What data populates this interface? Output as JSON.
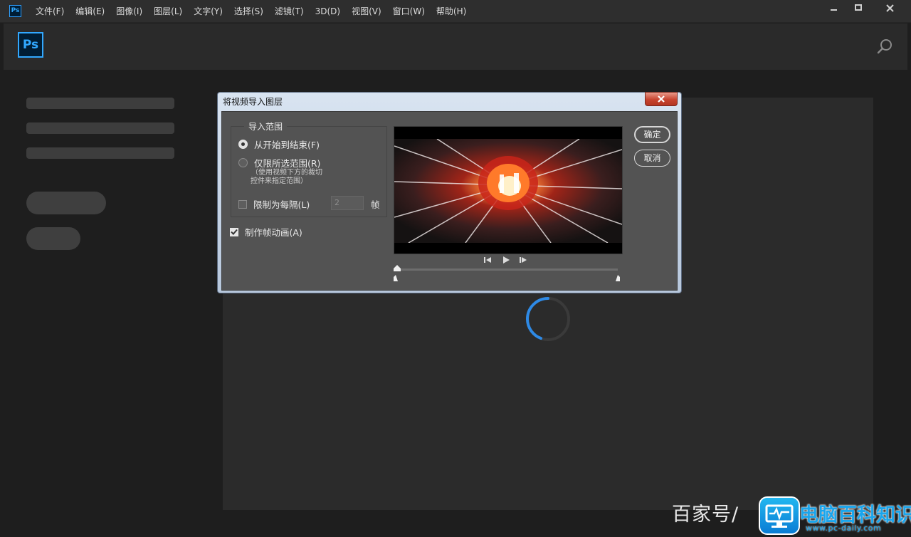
{
  "app": {
    "icon_label": "Ps",
    "logo_label": "Ps"
  },
  "menu": {
    "items": [
      "文件(F)",
      "编辑(E)",
      "图像(I)",
      "图层(L)",
      "文字(Y)",
      "选择(S)",
      "滤镜(T)",
      "3D(D)",
      "视图(V)",
      "窗口(W)",
      "帮助(H)"
    ]
  },
  "window_controls": [
    "minimize-icon",
    "maximize-icon",
    "close-icon"
  ],
  "dialog": {
    "title": "将视频导入图层",
    "range_group_label": "导入范围",
    "option_from_start_to_end": "从开始到结束(F)",
    "option_selected_range": "仅限所选范围(R)",
    "selected_range_hint_line1": "（使用视频下方的裁切",
    "selected_range_hint_line2": "控件来指定范围）",
    "limit_every_label": "限制为每隔(L)",
    "limit_every_value": "2",
    "limit_every_unit": "帧",
    "make_frame_animation_label": "制作帧动画(A)",
    "ok_label": "确定",
    "cancel_label": "取消",
    "selected_option": "from_start_to_end",
    "limit_every_checked": false,
    "make_frame_animation_checked": true
  },
  "theme": {
    "ps_blue": "#31a8ff",
    "spinner_blue": "#2e8ae6"
  },
  "watermark": {
    "left_text": "百家号/",
    "brand": "电脑百科知识",
    "url": "www.pc-daily.com"
  }
}
